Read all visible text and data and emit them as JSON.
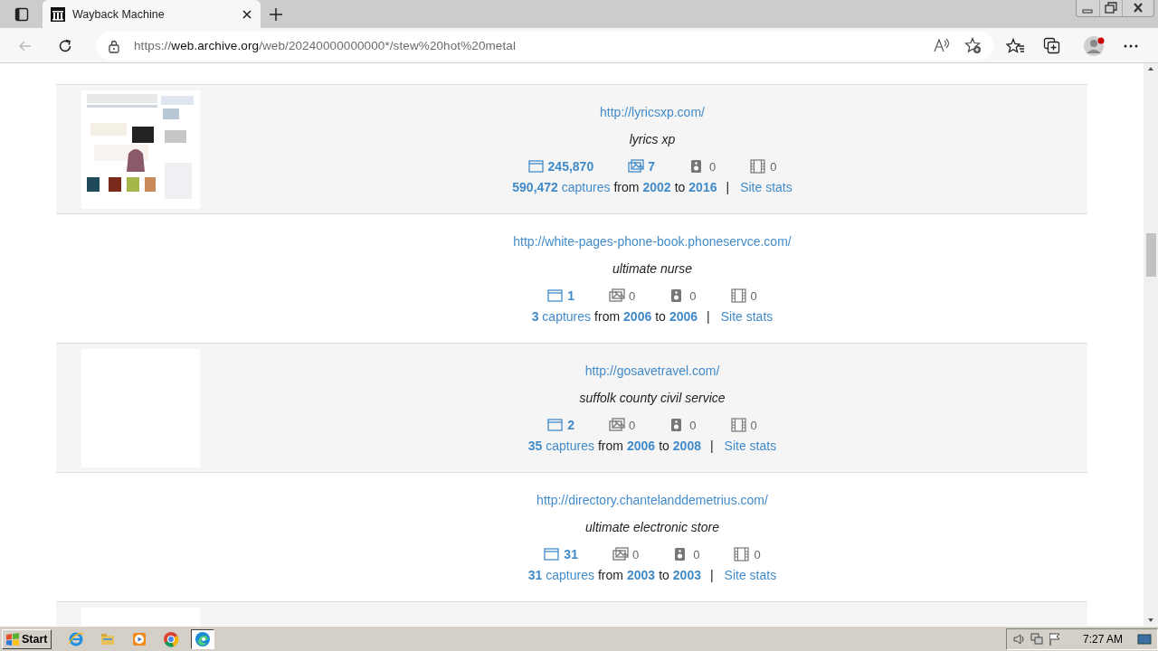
{
  "browser": {
    "tab": {
      "title": "Wayback Machine",
      "selected": true
    },
    "address": {
      "scheme": "https://",
      "host": "web.archive.org",
      "path": "/web/20240000000000*/stew%20hot%20metal"
    }
  },
  "results": [
    {
      "thumbnail": {
        "kind": "picture"
      },
      "url": "http://lyricsxp.com/",
      "description": "lyrics xp",
      "stats": [
        {
          "kind": "pages",
          "value": "245,870",
          "active": true
        },
        {
          "kind": "images",
          "value": "7",
          "active": true
        },
        {
          "kind": "audio",
          "value": "0",
          "active": false
        },
        {
          "kind": "video",
          "value": "0",
          "active": false
        }
      ],
      "captures": {
        "count": "590,472",
        "label": "captures",
        "from_word": "from",
        "from": "2002",
        "to_word": "to",
        "to": "2016",
        "separator": "|",
        "stats_link": "Site stats"
      }
    },
    {
      "url": "http://white-pages-phone-book.phoneservce.com/",
      "description": "ultimate nurse",
      "stats": [
        {
          "kind": "pages",
          "value": "1",
          "active": true
        },
        {
          "kind": "images",
          "value": "0",
          "active": false
        },
        {
          "kind": "audio",
          "value": "0",
          "active": false
        },
        {
          "kind": "video",
          "value": "0",
          "active": false
        }
      ],
      "captures": {
        "count": "3",
        "label": "captures",
        "from_word": "from",
        "from": "2006",
        "to_word": "to",
        "to": "2006",
        "separator": "|",
        "stats_link": "Site stats"
      }
    },
    {
      "thumbnail": {
        "kind": "blank"
      },
      "url": "http://gosavetravel.com/",
      "description": "suffolk county civil service",
      "stats": [
        {
          "kind": "pages",
          "value": "2",
          "active": true
        },
        {
          "kind": "images",
          "value": "0",
          "active": false
        },
        {
          "kind": "audio",
          "value": "0",
          "active": false
        },
        {
          "kind": "video",
          "value": "0",
          "active": false
        }
      ],
      "captures": {
        "count": "35",
        "label": "captures",
        "from_word": "from",
        "from": "2006",
        "to_word": "to",
        "to": "2008",
        "separator": "|",
        "stats_link": "Site stats"
      }
    },
    {
      "url": "http://directory.chantelanddemetrius.com/",
      "description": "ultimate electronic store",
      "stats": [
        {
          "kind": "pages",
          "value": "31",
          "active": true
        },
        {
          "kind": "images",
          "value": "0",
          "active": false
        },
        {
          "kind": "audio",
          "value": "0",
          "active": false
        },
        {
          "kind": "video",
          "value": "0",
          "active": false
        }
      ],
      "captures": {
        "count": "31",
        "label": "captures",
        "from_word": "from",
        "from": "2003",
        "to_word": "to",
        "to": "2003",
        "separator": "|",
        "stats_link": "Site stats"
      }
    },
    {
      "thumbnail": {
        "kind": "blank"
      }
    }
  ],
  "taskbar": {
    "start": "Start",
    "apps": [
      {
        "kind": "ie",
        "selected": false
      },
      {
        "kind": "explorer",
        "selected": false
      },
      {
        "kind": "media",
        "selected": false
      },
      {
        "kind": "chrome",
        "selected": false
      },
      {
        "kind": "edge",
        "selected": true
      }
    ],
    "clock": "7:27 AM"
  }
}
